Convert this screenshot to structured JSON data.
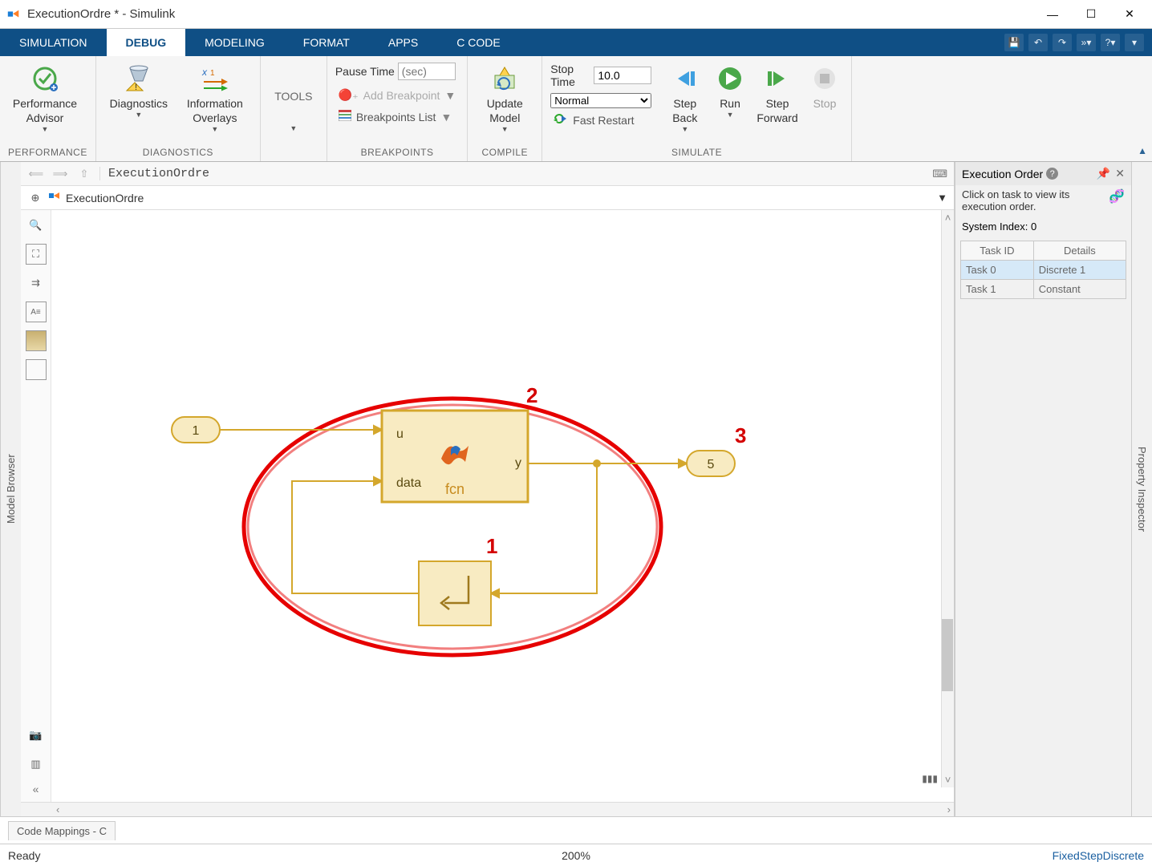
{
  "window": {
    "title": "ExecutionOrdre * - Simulink"
  },
  "tabs": {
    "items": [
      "SIMULATION",
      "DEBUG",
      "MODELING",
      "FORMAT",
      "APPS",
      "C CODE"
    ],
    "active": 1
  },
  "ribbon": {
    "performance": {
      "label": "PERFORMANCE",
      "btn": "Performance\nAdvisor"
    },
    "diagnostics": {
      "label": "DIAGNOSTICS",
      "btn1": "Diagnostics",
      "btn2": "Information\nOverlays"
    },
    "tools": {
      "btn": "TOOLS"
    },
    "breakpoints": {
      "label": "BREAKPOINTS",
      "pause_label": "Pause Time",
      "pause_ph": "(sec)",
      "add": "Add Breakpoint",
      "list": "Breakpoints List"
    },
    "compile": {
      "label": "COMPILE",
      "btn": "Update\nModel"
    },
    "simulate": {
      "label": "SIMULATE",
      "stop_label": "Stop Time",
      "stop_val": "10.0",
      "mode": "Normal",
      "fast": "Fast Restart",
      "step_back": "Step\nBack",
      "run": "Run",
      "step_fwd": "Step\nForward",
      "stop": "Stop"
    }
  },
  "nav": {
    "breadcrumb": "ExecutionOrdre",
    "path": "ExecutionOrdre"
  },
  "side_tabs": {
    "left": "Model Browser",
    "right": "Property Inspector"
  },
  "exec_panel": {
    "title": "Execution Order",
    "hint": "Click on task to view its execution order.",
    "sys": "System Index: 0",
    "cols": [
      "Task ID",
      "Details"
    ],
    "rows": [
      {
        "id": "Task 0",
        "d": "Discrete 1",
        "sel": true
      },
      {
        "id": "Task 1",
        "d": "Constant",
        "sel": false
      }
    ]
  },
  "diagram": {
    "inport": "1",
    "outport": "5",
    "fcn_u": "u",
    "fcn_data": "data",
    "fcn_y": "y",
    "fcn_name": "fcn",
    "order1": "1",
    "order2": "2",
    "order3": "3"
  },
  "code_map": "Code Mappings - C",
  "status": {
    "left": "Ready",
    "center": "200%",
    "right": "FixedStepDiscrete"
  }
}
